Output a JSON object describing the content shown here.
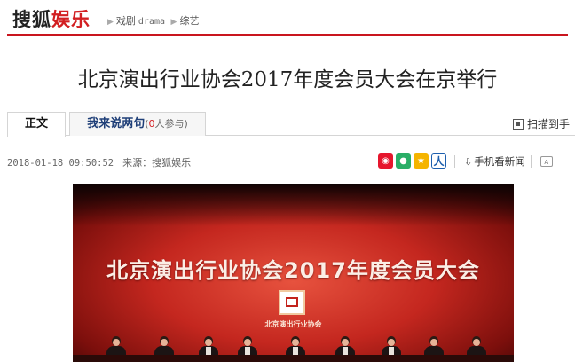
{
  "header": {
    "logo_part1": "搜狐",
    "logo_part2": "娱乐",
    "breadcrumb": {
      "item1": "戏剧",
      "item1_en": "drama",
      "item2": "综艺"
    }
  },
  "article": {
    "title": "北京演出行业协会2017年度会员大会在京举行",
    "date": "2018-01-18 09:50:52",
    "source": "来源：搜狐娱乐"
  },
  "tabs": {
    "main_label": "正文",
    "comments_label": "我来说两句",
    "comments_count_num": "0",
    "comments_count_suffix": "人参与",
    "comments_open": "(",
    "comments_close": ")"
  },
  "toolbar": {
    "scan_label": "扫描到手",
    "mobile_label": "手机看新闻",
    "renren_glyph": "人",
    "mobile_glyph": "⇩",
    "tool_glyph": "A"
  },
  "photo": {
    "banner_text": "北京演出行业协会2017年度会员大会",
    "association_label": "北京演出行业协会"
  },
  "colors": {
    "brand_red": "#c9151e",
    "link_blue": "#1f3f78",
    "weibo": "#e6162d",
    "wechat": "#2aae67",
    "qzone": "#f5b400"
  },
  "icons": [
    "qr-scan-icon",
    "weibo-icon",
    "wechat-icon",
    "qzone-icon",
    "renren-icon",
    "mobile-icon",
    "font-size-icon"
  ]
}
